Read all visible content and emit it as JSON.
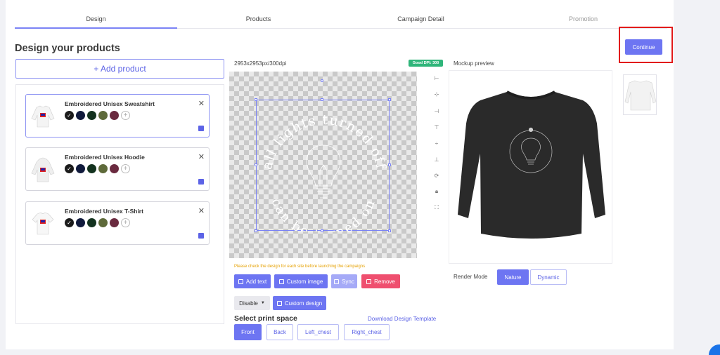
{
  "tabs": [
    {
      "label": "Design"
    },
    {
      "label": "Products"
    },
    {
      "label": "Campaign Detail"
    },
    {
      "label": "Promotion"
    }
  ],
  "page_title": "Design your products",
  "add_product_label": "+ Add product",
  "products": [
    {
      "name": "Embroidered Unisex Sweatshirt",
      "close": "✕"
    },
    {
      "name": "Embroidered Unisex Hoodie",
      "close": "✕"
    },
    {
      "name": "Embroidered Unisex T-Shirt",
      "close": "✕"
    }
  ],
  "swatch_colors": [
    "#1b1b1b",
    "#101a3c",
    "#13321f",
    "#5e6a3a",
    "#6a2a3f"
  ],
  "canvas": {
    "dimensions": "2953x2953px/300dpi",
    "dpi_badge": "Good DPI: 300",
    "design_text_top": "all lights turned off",
    "design_text_bottom": "can be turned on"
  },
  "toolbar_icons": [
    "align-left-icon",
    "align-center-h-icon",
    "align-right-icon",
    "align-top-icon",
    "align-middle-icon",
    "align-bottom-icon",
    "rotate-icon",
    "lock-icon",
    "fit-icon"
  ],
  "mockup": {
    "label": "Mockup preview"
  },
  "continue_label": "Continue",
  "warning_text": "Please check the design for each site before launching the campaigns",
  "actions": {
    "add_text": "Add text",
    "custom_image": "Custom image",
    "sync": "Sync",
    "remove": "Remove",
    "disable": "Disable",
    "custom_design": "Custom design"
  },
  "print_space": {
    "title": "Select print space",
    "download_template": "Download Design Template",
    "options": [
      "Front",
      "Back",
      "Left_chest",
      "Right_chest"
    ],
    "selected": "Front"
  },
  "render_mode": {
    "label": "Render Mode",
    "options": [
      "Nature",
      "Dynamic"
    ],
    "selected": "Nature"
  },
  "colors": {
    "accent": "#6d75f2",
    "danger": "#ef4f6f",
    "success": "#2fb57a",
    "warning": "#e6a100",
    "highlight_box": "#e21b1b"
  }
}
